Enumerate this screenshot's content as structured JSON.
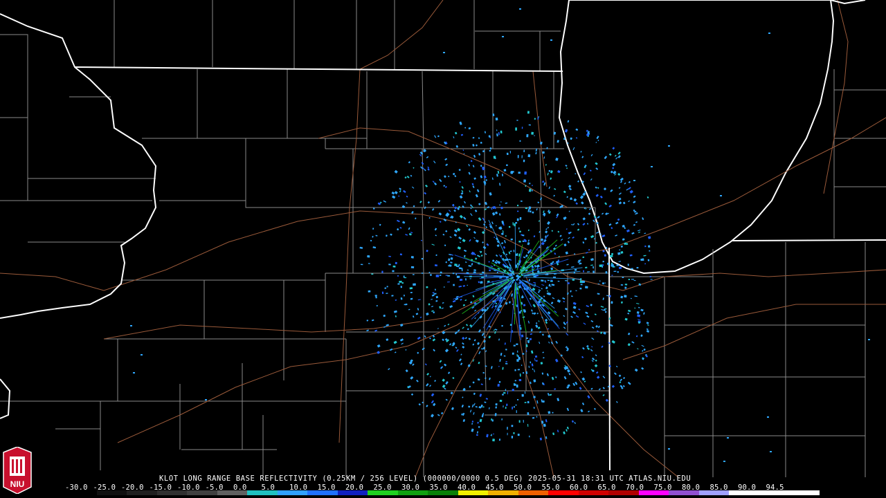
{
  "header": {
    "caption": "KLOT LONG RANGE BASE REFLECTIVITY (0.25KM / 256 LEVEL) (000000/0000 0.5 DEG) 2025-05-31 18:31 UTC  ATLAS.NIU.EDU"
  },
  "scale": {
    "labels": [
      "-30.0",
      "-25.0",
      "-20.0",
      "-15.0",
      "-10.0",
      "-5.0",
      "0.0",
      "5.0",
      "10.0",
      "15.0",
      "20.0",
      "25.0",
      "30.0",
      "35.0",
      "40.0",
      "45.0",
      "50.0",
      "55.0",
      "60.0",
      "65.0",
      "70.0",
      "75.0",
      "80.0",
      "85.0",
      "90.0",
      "94.5"
    ],
    "colors": [
      "#000000",
      "#101010",
      "#202020",
      "#303030",
      "#404040",
      "#606060",
      "#20c0c0",
      "#30a0ff",
      "#2070ff",
      "#1020c0",
      "#20d020",
      "#10a010",
      "#088008",
      "#f0f000",
      "#f0b000",
      "#f06000",
      "#ff0000",
      "#d00000",
      "#b00000",
      "#ff00ff",
      "#9050d0",
      "#a0a0ff",
      "#ffffff",
      "#ffffff",
      "#ffffff"
    ]
  },
  "logo": {
    "text": "NIU",
    "colors": {
      "background": "#c8102e",
      "foreground": "#ffffff"
    }
  },
  "map": {
    "colors": {
      "background": "#000000",
      "coastline": "#ffffff",
      "state_border": "#ffffff",
      "county": "#8a8a8a",
      "highway": "#9a5a3a",
      "echo_light": "#2fa8ff",
      "echo_medium": "#2060ff",
      "echo_cyan": "#22c8d0",
      "echo_green": "#20d020"
    },
    "radar_site": "KLOT"
  }
}
